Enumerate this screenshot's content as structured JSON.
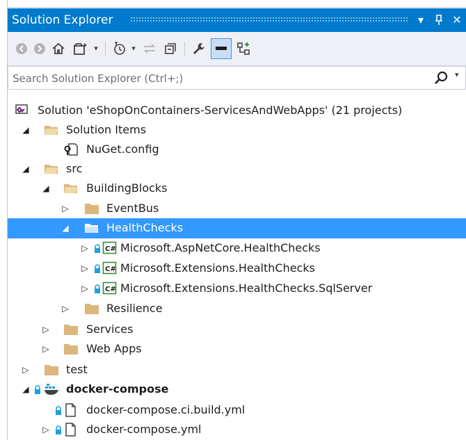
{
  "window": {
    "title": "Solution Explorer"
  },
  "search": {
    "placeholder": "Search Solution Explorer (Ctrl+;)"
  },
  "tree": {
    "solution": "Solution 'eShopOnContainers-ServicesAndWebApps' (21 projects)",
    "solution_items": "Solution Items",
    "nuget_config": "NuGet.config",
    "src": "src",
    "building_blocks": "BuildingBlocks",
    "event_bus": "EventBus",
    "health_checks": "HealthChecks",
    "aspnetcore_healthchecks": "Microsoft.AspNetCore.HealthChecks",
    "extensions_healthchecks": "Microsoft.Extensions.HealthChecks",
    "extensions_healthchecks_sqlserver": "Microsoft.Extensions.HealthChecks.SqlServer",
    "resilience": "Resilience",
    "services": "Services",
    "web_apps": "Web Apps",
    "test": "test",
    "docker_compose": "docker-compose",
    "docker_compose_ci_build": "docker-compose.ci.build.yml",
    "docker_compose_yml": "docker-compose.yml"
  },
  "colors": {
    "accent": "#007acc",
    "selection": "#3399ff",
    "folder": "#dcb67a",
    "lock": "#1ba1e2",
    "csharp": "#388a34",
    "solution": "#68217a"
  }
}
